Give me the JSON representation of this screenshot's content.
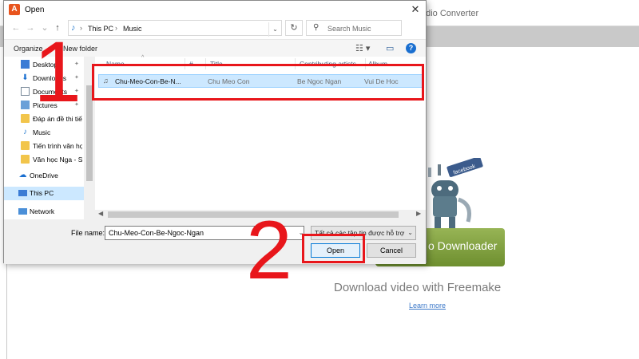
{
  "background_app": {
    "title_fragment": "udio Converter",
    "download_button": "o Downloader",
    "headline": "Download video with Freemake",
    "learn_more": "Learn more",
    "badge": "facebook"
  },
  "dialog": {
    "title": "Open",
    "close_glyph": "✕",
    "app_icon_letter": "A",
    "address": {
      "crumbs": [
        "This PC",
        "Music"
      ]
    },
    "search_placeholder": "Search Music",
    "commands": {
      "organize": "Organize",
      "new_folder": "New folder"
    },
    "nav_items": [
      {
        "label": "Desktop",
        "icon": "desktop-icon",
        "pinned": true
      },
      {
        "label": "Downloads",
        "icon": "downloads-icon",
        "pinned": true
      },
      {
        "label": "Documents",
        "icon": "documents-icon",
        "pinned": true
      },
      {
        "label": "Pictures",
        "icon": "pictures-icon",
        "pinned": true
      },
      {
        "label": "Đáp án đề thi tiế",
        "icon": "folder-icon"
      },
      {
        "label": "Music",
        "icon": "music-icon"
      },
      {
        "label": "Tiến trình văn họ",
        "icon": "folder-icon"
      },
      {
        "label": "Văn học Nga - Sl",
        "icon": "folder-icon"
      },
      {
        "label": "OneDrive",
        "icon": "onedrive-icon"
      },
      {
        "label": "This PC",
        "icon": "this-pc-icon",
        "selected": true
      },
      {
        "label": "Network",
        "icon": "network-icon"
      }
    ],
    "columns": [
      "Name",
      "#",
      "Title",
      "Contributing artists",
      "Album"
    ],
    "files": [
      {
        "name": "Chu-Meo-Con-Be-N...",
        "title": "Chu Meo Con",
        "artist": "Be Ngoc Ngan",
        "album": "Vui De Hoc"
      }
    ],
    "file_name_label": "File name:",
    "file_name_value": "Chu-Meo-Con-Be-Ngoc-Ngan",
    "filter_value": "Tất cả các tập tin được hỗ trợ",
    "open_label": "Open",
    "cancel_label": "Cancel"
  },
  "annotations": {
    "step1": "1",
    "step2": "2"
  },
  "colors": {
    "highlight": "#e8161b",
    "selection": "#cce8ff",
    "freemake_green": "#7d9d3a"
  }
}
